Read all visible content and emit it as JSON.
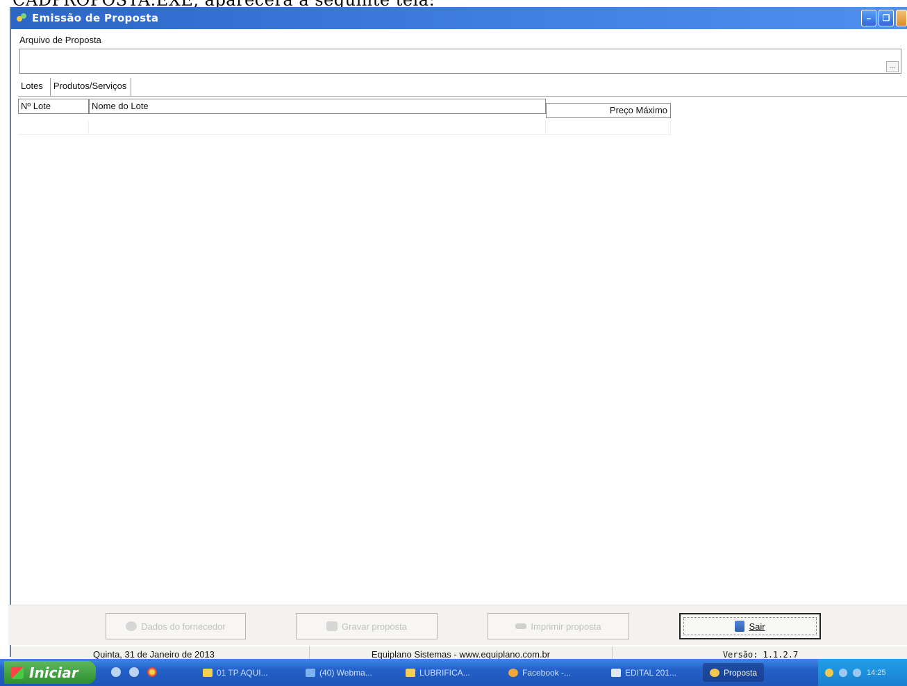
{
  "document_caption": "CADPROPOSTA.EXE, aparecerá a seguinte tela:",
  "window": {
    "title": "Emissão de Proposta",
    "app_icon": "app-icon",
    "controls": [
      "minimize-icon",
      "restore-icon",
      "close-icon"
    ]
  },
  "file": {
    "label": "Arquivo de Proposta",
    "value": "",
    "browse_label": "..."
  },
  "tabs": [
    {
      "label": "Lotes",
      "active": true
    },
    {
      "label": "Produtos/Serviços",
      "active": false
    }
  ],
  "grid": {
    "columns": [
      "Nº Lote",
      "Nome do Lote",
      "Preço Máximo"
    ],
    "rows": []
  },
  "buttons": {
    "dados": "Dados do fornecedor",
    "gravar": "Gravar proposta",
    "imprimir": "Imprimir proposta",
    "sair": "Sair"
  },
  "status": {
    "date": "Quinta, 31 de Janeiro de 2013",
    "company": "Equiplano Sistemas - www.equiplano.com.br",
    "version": "Versão: 1.1.2.7"
  },
  "taskbar": {
    "start": "Iniciar",
    "items": [
      "01 TP AQUI...",
      "(40) Webma...",
      "LUBRIFICA...",
      "Facebook -...",
      "EDITAL 201...",
      "Proposta"
    ],
    "clock": "14:25"
  }
}
